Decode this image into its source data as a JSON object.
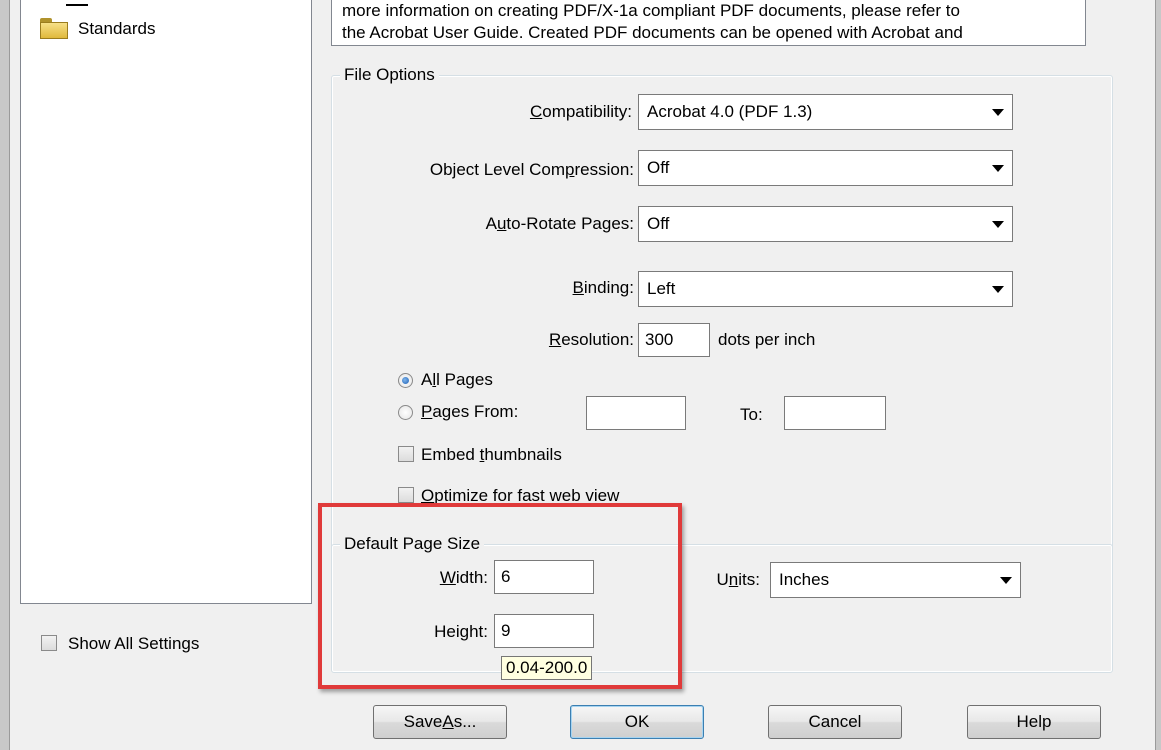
{
  "colors": {
    "highlight_border": "#e03a3a",
    "tooltip_bg": "#ffffe1",
    "dialog_bg": "#f0f0f0"
  },
  "tree": {
    "items": [
      {
        "label": "Standards",
        "icon": "folder-icon"
      }
    ]
  },
  "description": {
    "lines": [
      "more information on creating PDF/X-1a compliant PDF documents, please refer to",
      "the Acrobat User Guide.  Created PDF documents can be opened with Acrobat and"
    ]
  },
  "file_options": {
    "title": "File Options",
    "compatibility": {
      "label": "Compatibility:",
      "value": "Acrobat 4.0 (PDF 1.3)"
    },
    "object_compression": {
      "label": "Object Level Compression:",
      "value": "Off"
    },
    "auto_rotate": {
      "label": "Auto-Rotate Pages:",
      "value": "Off"
    },
    "binding": {
      "label": "Binding:",
      "value": "Left"
    },
    "resolution": {
      "label": "Resolution:",
      "value": "300",
      "unit": "dots per inch"
    },
    "all_pages": {
      "label": "All Pages",
      "selected": true
    },
    "pages_from": {
      "label": "Pages From:",
      "from_value": "",
      "to_label": "To:",
      "to_value": ""
    },
    "embed_thumbnails": {
      "label": "Embed thumbnails",
      "checked": false
    },
    "optimize_web": {
      "label": "Optimize for fast web view",
      "checked": false
    }
  },
  "page_size": {
    "title": "Default Page Size",
    "width": {
      "label": "Width:",
      "value": "6"
    },
    "height": {
      "label": "Height:",
      "value": "9"
    },
    "units": {
      "label": "Units:",
      "value": "Inches"
    },
    "tooltip": "0.04-200.0"
  },
  "show_all_settings": {
    "label": "Show All Settings",
    "checked": false
  },
  "buttons": {
    "save_as": "Save As...",
    "ok": "OK",
    "cancel": "Cancel",
    "help": "Help"
  }
}
